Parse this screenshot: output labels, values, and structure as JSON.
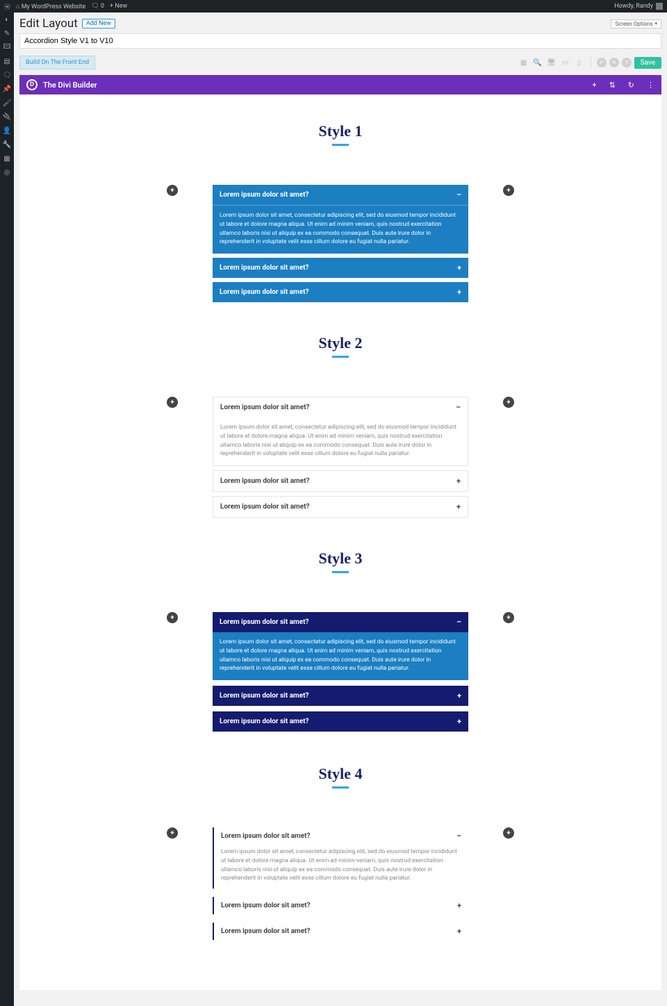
{
  "admin_bar": {
    "site_name": "My WordPress Website",
    "comments": "0",
    "new": "New",
    "howdy": "Howdy, Randy"
  },
  "screen_options": "Screen Options",
  "page": {
    "title": "Edit Layout",
    "add_new": "Add New",
    "post_title": "Accordion Style V1 to V10"
  },
  "toolbar": {
    "build_front": "Build On The Front End",
    "save": "Save"
  },
  "divi": {
    "title": "The Divi Builder"
  },
  "lorem": "Lorem ipsum dolor sit amet, consectetur adipiscing elit, sed do eiusmod tempor incididunt ut labore et dolore magna aliqua. Ut enim ad minim veniam, quis nostrud exercitation ullamco laboris nisi ut aliquip ex ea commodo consequat. Duis aute irure dolor in reprehenderit in voluptate velit esse cillum dolore eu fugiat nulla pariatur.",
  "q": "Lorem ipsum dolor sit amet?",
  "plus": "+",
  "minus": "–",
  "styles": {
    "s1": "Style 1",
    "s2": "Style 2",
    "s3": "Style 3",
    "s4": "Style 4"
  }
}
